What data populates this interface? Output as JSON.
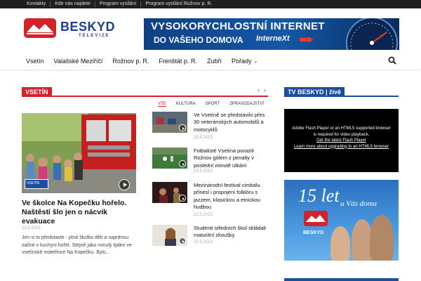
{
  "topbar": {
    "links": [
      "Kontakty",
      "Kde nás najdete",
      "Program vysílání",
      "Program vysílání Rožnov p. R."
    ]
  },
  "logo": {
    "name": "BESKYD",
    "sub": "TELEVIZE"
  },
  "banner": {
    "line1": "VYSOKORYCHLOSTNÍ INTERNET",
    "line2": "DO VAŠEHO DOMOVA",
    "brand": "InterneXt"
  },
  "nav": {
    "items": [
      "Vsetín",
      "Valašské Meziříčí",
      "Rožnov p. R.",
      "Frenštát p. R.",
      "Zubří",
      "Pořady"
    ]
  },
  "section": {
    "title": "VSETÍN",
    "pager": {
      "prev": "‹",
      "next": "›"
    },
    "categories": [
      "VŠE",
      "KULTURA",
      "SPORT",
      "ZPRAVODAJSTVÍ"
    ],
    "active_category": "VŠE"
  },
  "main_article": {
    "badge": "VSETÍN",
    "title": "Ve školce Na Kopečku hořelo. Naštěstí šlo jen o nácvik evakuace",
    "date": "23.5.2013",
    "excerpt": "Jen si to představte - plná školka dětí a najednou začne v kuchyni hořet. Stejně jako minulý týden ve vsetínské mateřince Na Kopečku. Bylo..."
  },
  "side_articles": [
    {
      "title": "Ve Vsetíně se představilo přes 30 veteránských automobilů a motocyklů",
      "date": "23.5.2013"
    },
    {
      "title": "Fotbalisté Vsetína porazili Rožnov gólem z penalty v poslední minutě utkání",
      "date": "23.5.2013"
    },
    {
      "title": "Mezinárodní festival cimbálu přinesl i propojení folklóru s jazzem, klasickou a etnickou hudbou",
      "date": "22.5.2013"
    },
    {
      "title": "Studenti středních škol skládali maturitní zkoušky",
      "date": "22.5.2013"
    }
  ],
  "sidebar": {
    "title": "TV BESKYD | živě",
    "flash": {
      "line1": "Adobe Flash Player or an HTML5 supported browser",
      "line2": "is required for video playback.",
      "link1": "Get the latest Flash Player",
      "link2": "Learn more about upgrading to an HTML5 browser"
    },
    "promo": {
      "big": "15 let",
      "small": "u Vás doma",
      "brand": "BESKYD"
    }
  },
  "colors": {
    "accent_red": "#d2232a",
    "accent_blue": "#1a4f9f",
    "topbar": "#1f1f1f"
  },
  "icons": {
    "search": "search-icon",
    "play": "play-icon"
  }
}
